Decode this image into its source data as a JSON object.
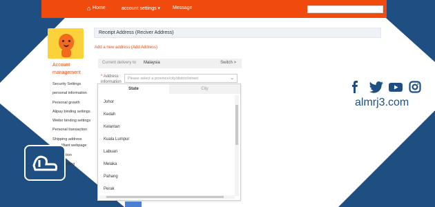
{
  "nav": {
    "home": "Home",
    "account_settings": "account settings",
    "message": "Message"
  },
  "sidebar": {
    "title": "Account management",
    "items": [
      {
        "label": "Security Settings"
      },
      {
        "label": "personal information"
      },
      {
        "label": "Personal growth"
      },
      {
        "label": "Alipay binding settings"
      },
      {
        "label": "Weibo binding settings"
      },
      {
        "label": "Personal transaction"
      },
      {
        "label": "Shipping address"
      },
      {
        "label": "Want webpage"
      },
      {
        "label": "tion"
      },
      {
        "label": "nding"
      }
    ]
  },
  "main": {
    "title": "Receipt Address (Reciver Address)",
    "add_link": "Add a new address (Add Address)",
    "delivery_label": "Current delivery to",
    "delivery_country": "Malaysia",
    "switch": "Switch >",
    "address_label_star": "*",
    "address_label": "Address information",
    "address_placeholder": "Please select a province/city/district/street"
  },
  "dropdown": {
    "tab_state": "State",
    "tab_city": "City",
    "states": [
      "Johor",
      "Kedah",
      "Kelantan",
      "Kuala Lumpur",
      "Labuan",
      "Melaka",
      "Pahang",
      "Perak"
    ]
  },
  "brand": {
    "site": "almrj3.com",
    "accent": "#f04a0c",
    "frame_color": "#1f4f82",
    "social_icons": [
      "facebook-icon",
      "twitter-icon",
      "youtube-icon",
      "instagram-icon"
    ]
  }
}
